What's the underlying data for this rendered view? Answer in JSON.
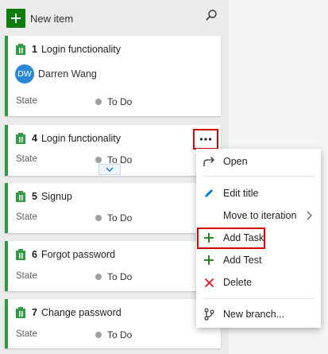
{
  "colors": {
    "accent_green": "#107c10",
    "card_stripe": "#339947",
    "highlight_red": "#d80000",
    "avatar_blue": "#2b88d8",
    "delete_red": "#e81123",
    "edit_blue": "#0078d4"
  },
  "toolbar": {
    "new_item_label": "New item",
    "new_item_icon": "plus-icon",
    "search_icon": "search-icon"
  },
  "cards": [
    {
      "id": "1",
      "title": "Login functionality",
      "assignee_initials": "DW",
      "assignee_name": "Darren Wang",
      "state_label": "State",
      "state_value": "To Do"
    },
    {
      "id": "4",
      "title": "Login functionality",
      "state_label": "State",
      "state_value": "To Do"
    },
    {
      "id": "5",
      "title": "Signup",
      "state_label": "State",
      "state_value": "To Do"
    },
    {
      "id": "6",
      "title": "Forgot password",
      "state_label": "State",
      "state_value": "To Do"
    },
    {
      "id": "7",
      "title": "Change password",
      "state_label": "State",
      "state_value": "To Do"
    }
  ],
  "context_menu": {
    "items": [
      {
        "label": "Open",
        "icon": "open-arrow-icon"
      },
      {
        "label": "Edit title",
        "icon": "pencil-icon"
      },
      {
        "label": "Move to iteration",
        "icon": "",
        "has_submenu": true
      },
      {
        "label": "Add Task",
        "icon": "plus-icon"
      },
      {
        "label": "Add Test",
        "icon": "plus-icon"
      },
      {
        "label": "Delete",
        "icon": "delete-x-icon"
      },
      {
        "label": "New branch...",
        "icon": "branch-icon"
      }
    ]
  }
}
